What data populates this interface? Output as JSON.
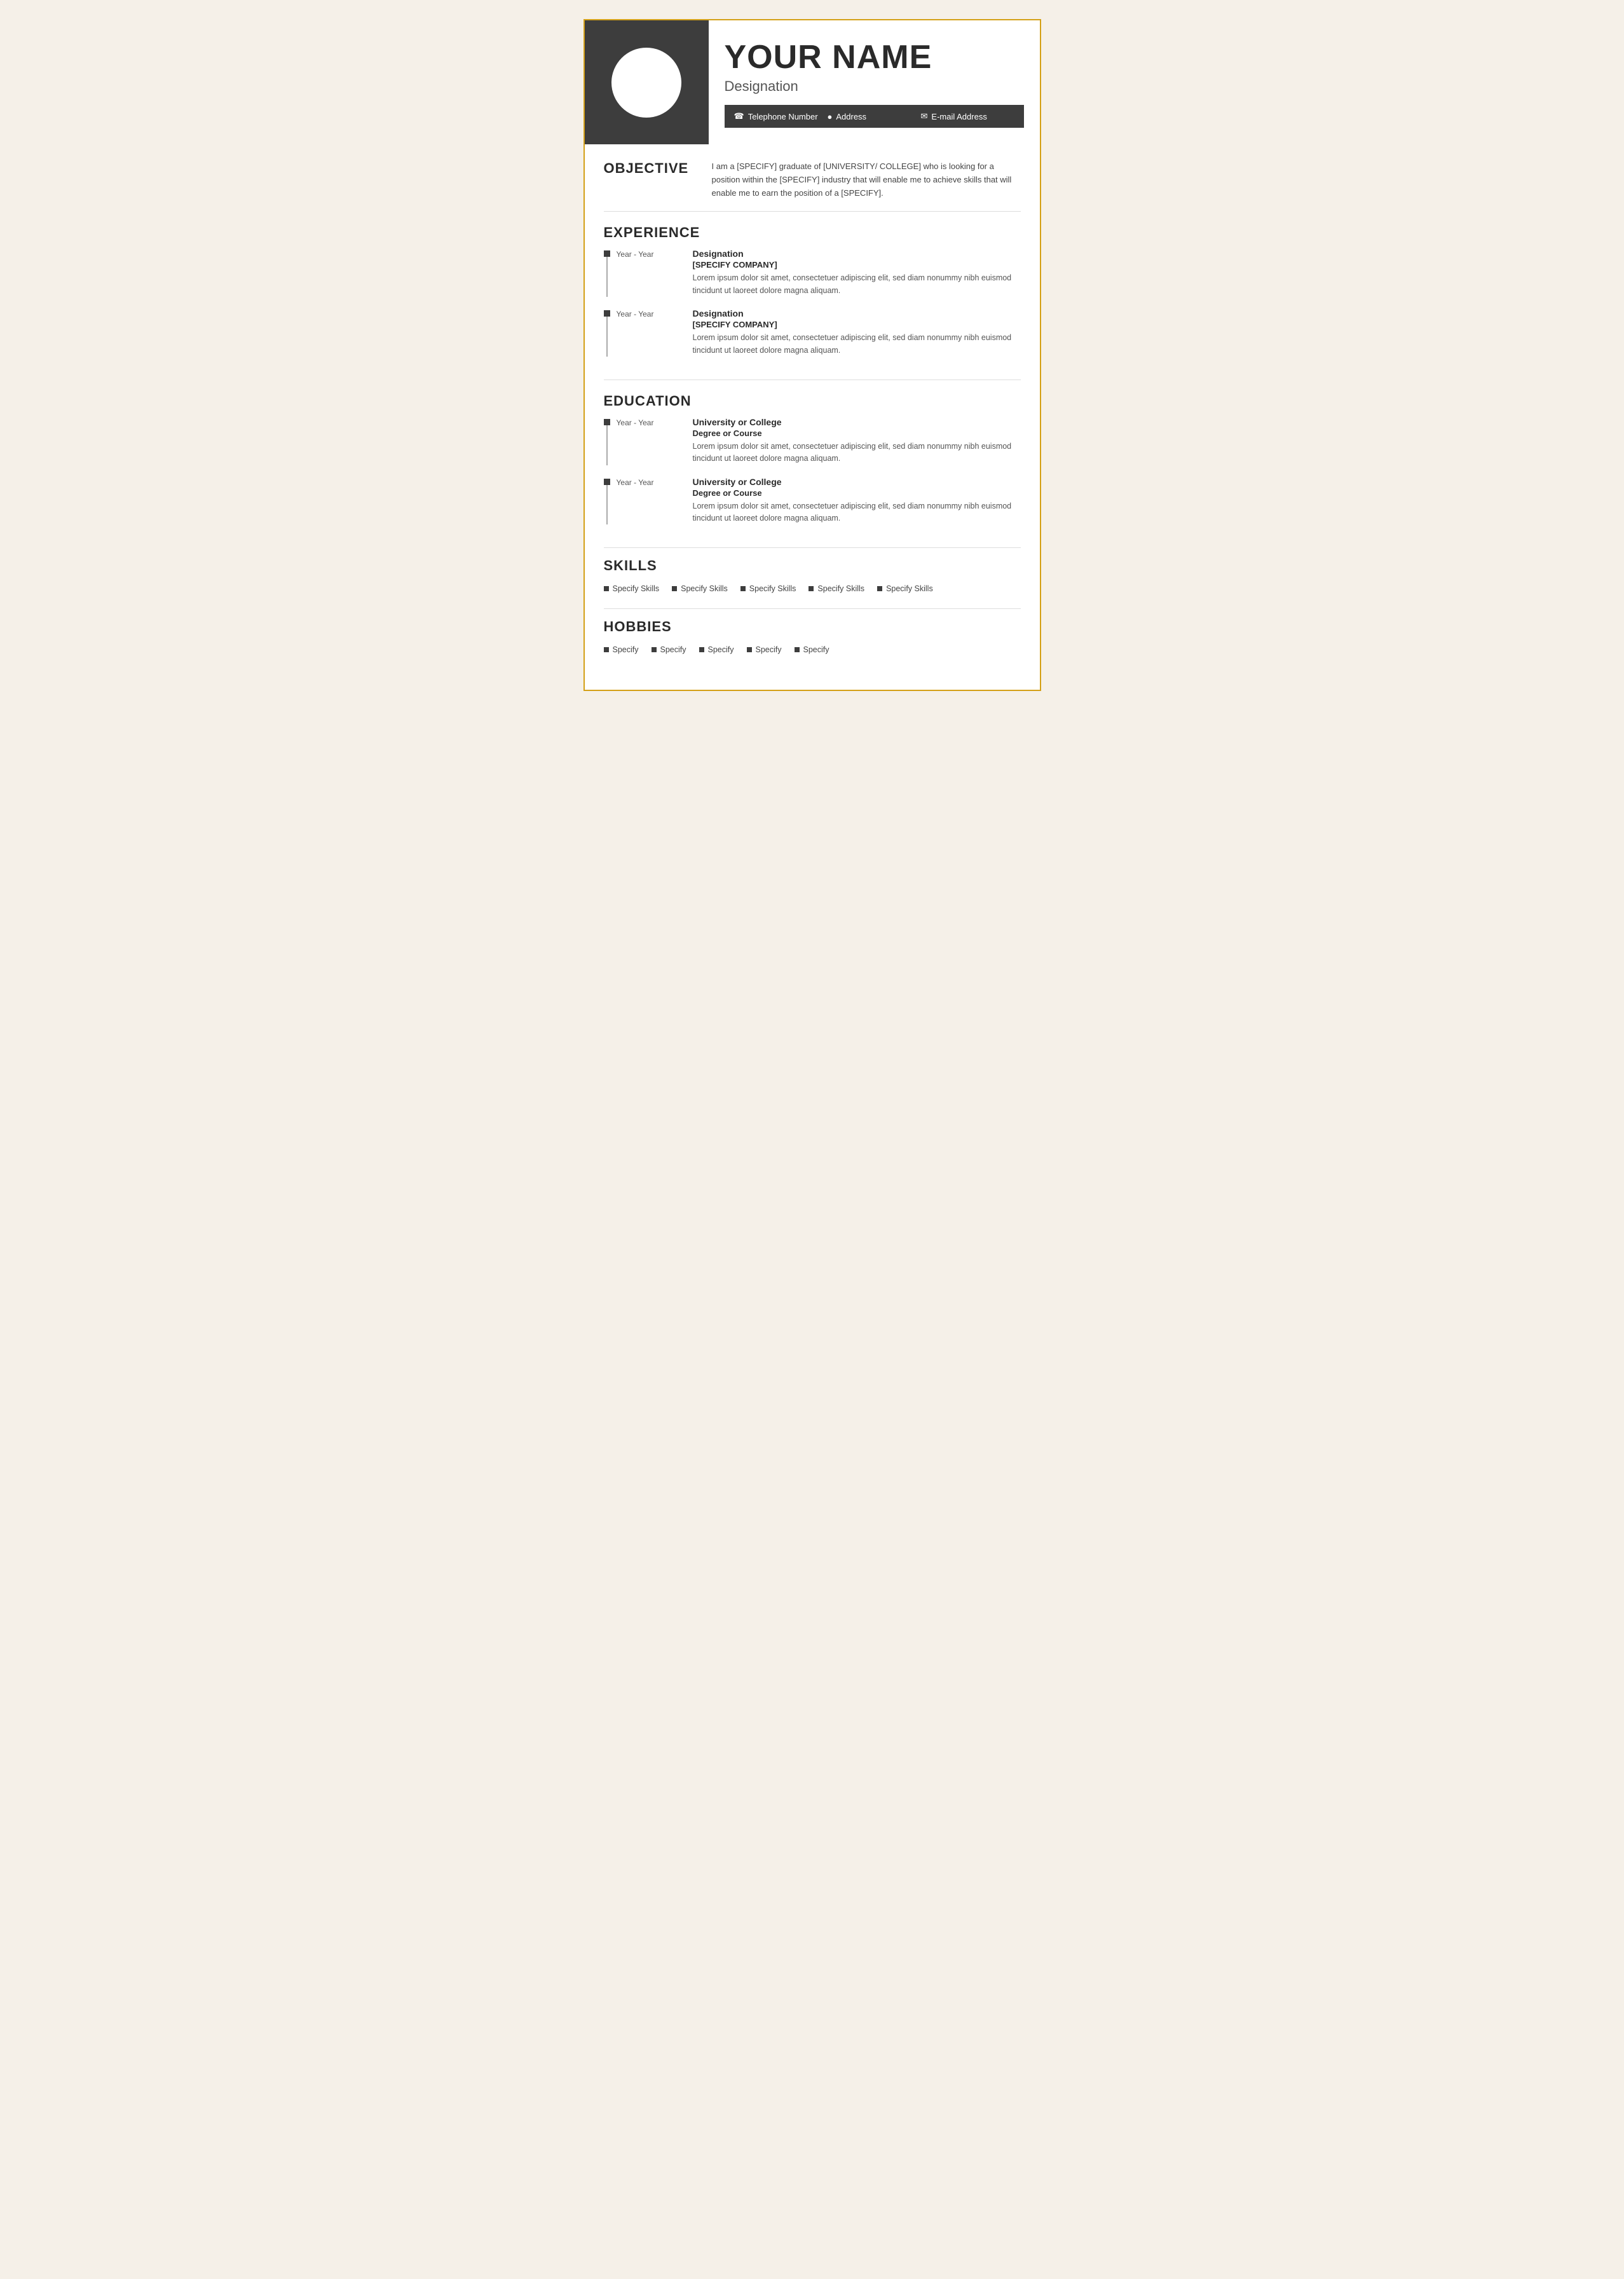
{
  "header": {
    "name": "YOUR NAME",
    "designation": "Designation",
    "contact": {
      "phone_icon": "☎",
      "phone": "Telephone Number",
      "address_icon": "📍",
      "address": "Address",
      "email_icon": "✉",
      "email": "E-mail Address"
    }
  },
  "objective": {
    "title": "OBJECTIVE",
    "text": "I am a [SPECIFY] graduate of [UNIVERSITY/ COLLEGE] who is looking for a position within the [SPECIFY] industry that will enable me to achieve skills that will enable me to earn the position of a [SPECIFY]."
  },
  "experience": {
    "title": "EXPERIENCE",
    "entries": [
      {
        "years": "Year - Year",
        "designation": "Designation",
        "company": "[SPECIFY COMPANY]",
        "description": "Lorem ipsum dolor sit amet, consectetuer adipiscing elit, sed diam nonummy nibh euismod tincidunt ut laoreet dolore magna aliquam."
      },
      {
        "years": "Year - Year",
        "designation": "Designation",
        "company": "[SPECIFY COMPANY]",
        "description": "Lorem ipsum dolor sit amet, consectetuer adipiscing elit, sed diam nonummy nibh euismod tincidunt ut laoreet dolore magna aliquam."
      }
    ]
  },
  "education": {
    "title": "EDUCATION",
    "entries": [
      {
        "years": "Year - Year",
        "institution": "University or College",
        "degree": "Degree or Course",
        "description": "Lorem ipsum dolor sit amet, consectetuer adipiscing elit, sed diam nonummy nibh euismod tincidunt ut laoreet dolore magna aliquam."
      },
      {
        "years": "Year - Year",
        "institution": "University or College",
        "degree": "Degree or Course",
        "description": "Lorem ipsum dolor sit amet, consectetuer adipiscing elit, sed diam nonummy nibh euismod tincidunt ut laoreet dolore magna aliquam."
      }
    ]
  },
  "skills": {
    "title": "SKILLS",
    "items": [
      "Specify Skills",
      "Specify Skills",
      "Specify Skills",
      "Specify Skills",
      "Specify Skills"
    ]
  },
  "hobbies": {
    "title": "HOBBIES",
    "items": [
      "Specify",
      "Specify",
      "Specify",
      "Specify",
      "Specify"
    ]
  },
  "colors": {
    "dark": "#3d3d3d",
    "accent": "#d4a017",
    "text": "#2a2a2a",
    "muted": "#555555"
  }
}
